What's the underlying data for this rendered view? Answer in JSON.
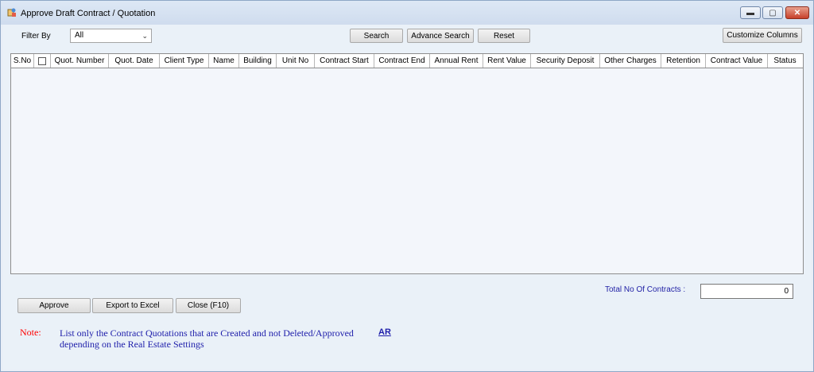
{
  "window": {
    "title": "Approve Draft Contract / Quotation",
    "controls": {
      "minimize": "▬",
      "maximize": "▢",
      "close": "✕"
    }
  },
  "filter": {
    "label": "Filter By",
    "value": "All"
  },
  "toolbar": {
    "search": "Search",
    "advance_search": "Advance Search",
    "reset": "Reset",
    "customize_columns": "Customize Columns"
  },
  "grid": {
    "columns": [
      "S.No",
      "",
      "Quot. Number",
      "Quot. Date",
      "Client Type",
      "Name",
      "Building",
      "Unit No",
      "Contract Start",
      "Contract End",
      "Annual Rent",
      "Rent Value",
      "Security Deposit",
      "Other Charges",
      "Retention",
      "Contract Value",
      "Status"
    ],
    "rows": []
  },
  "totals": {
    "label": "Total No Of Contracts :",
    "value": "0"
  },
  "actions": {
    "approve": "Approve",
    "export": "Export to Excel",
    "close": "Close (F10)"
  },
  "note": {
    "label": "Note:",
    "text": "List only the Contract Quotations that are Created and not Deleted/Approved depending on the Real Estate Settings",
    "link": "AR"
  },
  "colors": {
    "window_bg": "#eaf1f8",
    "note_label": "#ff0000",
    "note_text": "#1d1daa",
    "close_button": "#c7402a"
  }
}
